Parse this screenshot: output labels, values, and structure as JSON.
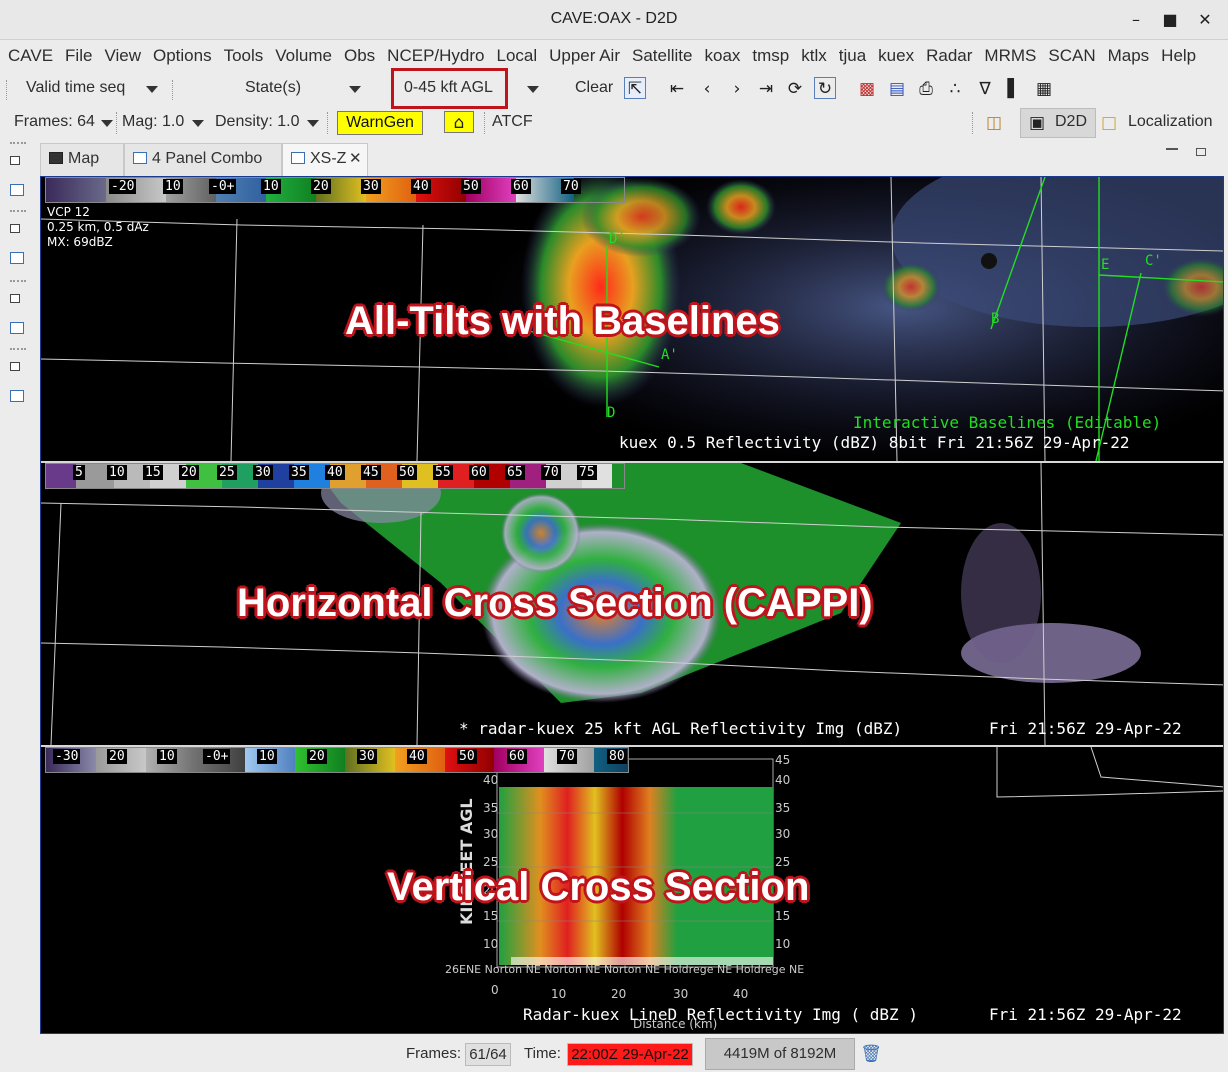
{
  "window": {
    "title": "CAVE:OAX - D2D"
  },
  "menu": [
    "CAVE",
    "File",
    "View",
    "Options",
    "Tools",
    "Volume",
    "Obs",
    "NCEP/Hydro",
    "Local",
    "Upper Air",
    "Satellite",
    "koax",
    "tmsp",
    "ktlx",
    "tjua",
    "kuex",
    "Radar",
    "MRMS",
    "SCAN",
    "Maps",
    "Help"
  ],
  "toolbar1": {
    "valid_time": "Valid time seq",
    "states": "State(s)",
    "height_range": "0-45 kft AGL",
    "clear": "Clear"
  },
  "toolbar2": {
    "frames": "Frames: 64",
    "mag": "Mag: 1.0",
    "density": "Density: 1.0",
    "warngen": "WarnGen",
    "atcf": "ATCF",
    "d2d": "D2D",
    "localization": "Localization"
  },
  "tabs": [
    {
      "label": "Map"
    },
    {
      "label": "4 Panel Combo"
    },
    {
      "label": "XS-Z"
    }
  ],
  "pane1": {
    "colorbar_labels": [
      "-20",
      "10",
      "-0+",
      "10",
      "20",
      "30",
      "40",
      "50",
      "60",
      "70"
    ],
    "info_lines": [
      "VCP 12",
      "0.25 km, 0.5 dAz",
      "MX: 69dBZ"
    ],
    "title": "All-Tilts with Baselines",
    "baseline_note": "Interactive Baselines (Editable)",
    "caption": "kuex 0.5  Reflectivity (dBZ) 8bit  Fri 21:56Z 29-Apr-22",
    "baseline_labels": [
      "D'",
      "A'",
      "D",
      "B",
      "E",
      "C'"
    ]
  },
  "pane2": {
    "colorbar_labels": [
      "5",
      "10",
      "15",
      "20",
      "25",
      "30",
      "35",
      "40",
      "45",
      "50",
      "55",
      "60",
      "65",
      "70",
      "75"
    ],
    "title": "Horizontal Cross Section (CAPPI)",
    "caption_left": "* radar-kuex 25 kft AGL Reflectivity Img (dBZ)",
    "caption_right": "Fri 21:56Z 29-Apr-22"
  },
  "pane3": {
    "colorbar_labels": [
      "-30",
      "20",
      "10",
      "-0+",
      "10",
      "20",
      "30",
      "40",
      "50",
      "60",
      "70",
      "80"
    ],
    "title": "Vertical Cross Section",
    "yaxis_label": "KILOFEET AGL",
    "y_ticks": [
      "40",
      "35",
      "30",
      "25",
      "20",
      "15",
      "10"
    ],
    "y_ticks_right": [
      "45",
      "40",
      "35",
      "30",
      "25",
      "20",
      "15",
      "10"
    ],
    "x_ticks": [
      "0",
      "10",
      "20",
      "30",
      "40"
    ],
    "x_axis_label": "Distance (km)",
    "location_labels": "26ENE Norton NE  Norton NE  Norton NE  Holdrege NE  Holdrege NE",
    "caption_left": "Radar-kuex LineD Reflectivity Img ( dBZ )",
    "caption_right": "Fri 21:56Z 29-Apr-22"
  },
  "status": {
    "frames_label": "Frames:",
    "frames_value": "61/64",
    "time_label": "Time:",
    "time_value": "22:00Z 29-Apr-22",
    "memory": "4419M of 8192M"
  },
  "colors": {
    "accent_red": "#c0141c",
    "warngen_yellow": "#ffff00",
    "time_red": "#ff1a1a",
    "baseline_green": "#22dd22"
  }
}
